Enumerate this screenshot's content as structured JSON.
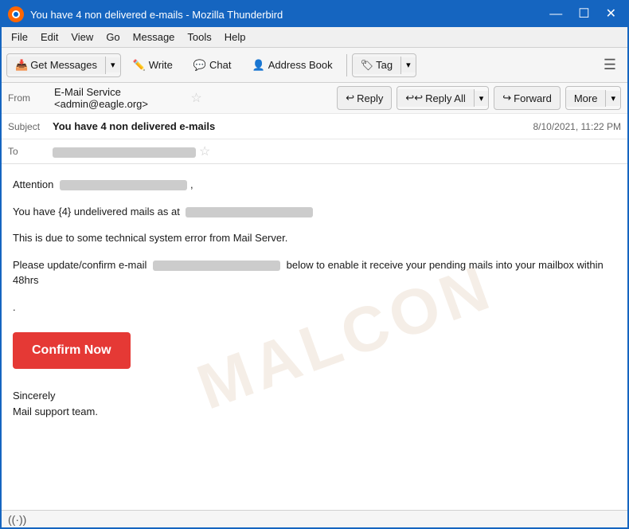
{
  "window": {
    "title": "You have 4 non delivered e-mails - Mozilla Thunderbird",
    "icon_text": "T",
    "controls": {
      "minimize": "—",
      "maximize": "☐",
      "close": "✕"
    }
  },
  "menu": {
    "items": [
      "File",
      "Edit",
      "View",
      "Go",
      "Message",
      "Tools",
      "Help"
    ]
  },
  "toolbar": {
    "get_messages": "Get Messages",
    "write": "Write",
    "chat": "Chat",
    "address_book": "Address Book",
    "tag": "Tag",
    "hamburger": "≡"
  },
  "email": {
    "from_label": "From",
    "from_value": "E-Mail Service <admin@eagle.org>",
    "subject_label": "Subject",
    "subject_value": "You have 4 non delivered e-mails",
    "date_value": "8/10/2021, 11:22 PM",
    "to_label": "To",
    "reply_btn": "Reply",
    "reply_all_btn": "Reply All",
    "forward_btn": "Forward",
    "more_btn": "More",
    "body": {
      "line1": "Attention",
      "line2_pre": "You have {4} undelivered mails as at",
      "line3": "This is due to some technical system error from Mail Server.",
      "line4_pre": "Please update/confirm e-mail",
      "line4_post": "below to enable it receive your pending mails into your mailbox within 48hrs",
      "line5": ".",
      "confirm_btn": "Confirm Now",
      "closing1": "Sincerely",
      "closing2": "Mail support team."
    }
  },
  "status": {
    "wifi_icon": "((·))"
  }
}
